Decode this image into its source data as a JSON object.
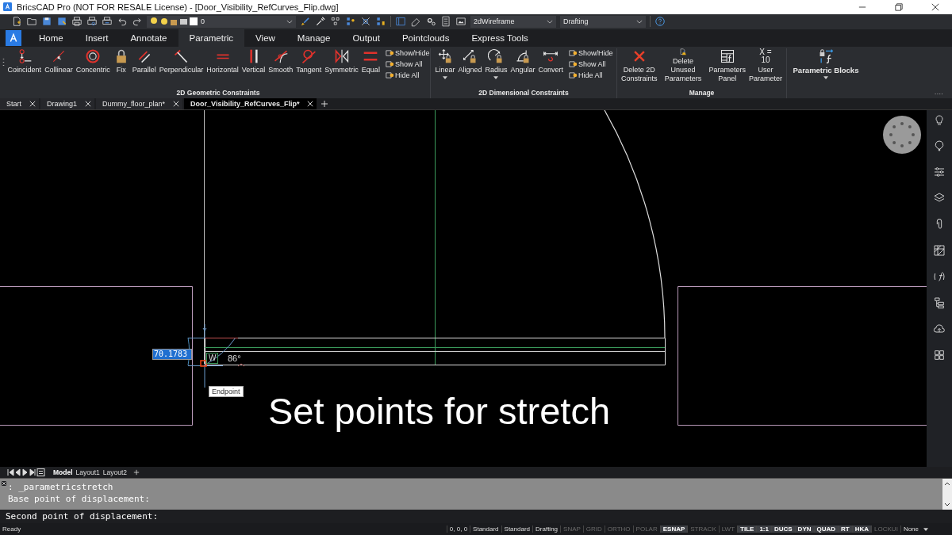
{
  "window": {
    "title": "BricsCAD Pro (NOT FOR RESALE License) - [Door_Visibility_RefCurves_Flip.dwg]"
  },
  "quick_access": {
    "layer": "0",
    "visual_style": "2dWireframe",
    "workspace": "Drafting"
  },
  "ribbon_tabs": [
    {
      "label": "Home",
      "selected": false
    },
    {
      "label": "Insert",
      "selected": false
    },
    {
      "label": "Annotate",
      "selected": false
    },
    {
      "label": "Parametric",
      "selected": true
    },
    {
      "label": "View",
      "selected": false
    },
    {
      "label": "Manage",
      "selected": false
    },
    {
      "label": "Output",
      "selected": false
    },
    {
      "label": "Pointclouds",
      "selected": false
    },
    {
      "label": "Express Tools",
      "selected": false
    }
  ],
  "ribbon_groups": [
    {
      "title": "2D Geometric Constraints",
      "buttons": [
        {
          "kind": "coincident",
          "label": "Coincident"
        },
        {
          "kind": "collinear",
          "label": "Collinear"
        },
        {
          "kind": "concentric",
          "label": "Concentric"
        },
        {
          "kind": "fix",
          "label": "Fix"
        },
        {
          "kind": "parallel",
          "label": "Parallel"
        },
        {
          "kind": "perpendicular",
          "label": "Perpendicular"
        },
        {
          "kind": "horizontal",
          "label": "Horizontal"
        },
        {
          "kind": "vertical",
          "label": "Vertical"
        },
        {
          "kind": "smooth",
          "label": "Smooth"
        },
        {
          "kind": "tangent",
          "label": "Tangent"
        },
        {
          "kind": "symmetric",
          "label": "Symmetric"
        },
        {
          "kind": "equal",
          "label": "Equal"
        }
      ],
      "small_buttons": [
        "Show/Hide",
        "Show All",
        "Hide All"
      ]
    },
    {
      "title": "2D Dimensional Constraints",
      "buttons": [
        {
          "kind": "linear",
          "label": "Linear",
          "dropdown": true
        },
        {
          "kind": "aligned",
          "label": "Aligned"
        },
        {
          "kind": "radius",
          "label": "Radius",
          "dropdown": true
        },
        {
          "kind": "angular",
          "label": "Angular"
        },
        {
          "kind": "convert",
          "label": "Convert"
        }
      ],
      "small_buttons": [
        "Show/Hide",
        "Show All",
        "Hide All"
      ]
    },
    {
      "title": "Manage",
      "buttons": [
        {
          "kind": "delete",
          "label": "Delete 2D\nConstraints"
        },
        {
          "kind": "purge",
          "label": "Delete Unused\nParameters"
        },
        {
          "kind": "panel",
          "label": "Parameters\nPanel"
        },
        {
          "kind": "userparam",
          "label": "User\nParameter",
          "icon_lines": [
            "X =",
            "10"
          ]
        }
      ]
    },
    {
      "buttons": [
        {
          "kind": "blocks",
          "label": "Parametric Blocks",
          "dropdown": true
        }
      ]
    }
  ],
  "document_tabs": [
    {
      "label": "Start",
      "selected": false
    },
    {
      "label": "Drawing1",
      "selected": false
    },
    {
      "label": "Dummy_floor_plan*",
      "selected": false
    },
    {
      "label": "Door_Visibility_RefCurves_Flip*",
      "selected": true
    }
  ],
  "dynamic_input": {
    "value": "70.1783",
    "snap_marker": "W",
    "angle": "86°",
    "tooltip": "Endpoint"
  },
  "caption": "Set points for stretch",
  "layout_tabs": [
    {
      "label": "Model",
      "selected": true
    },
    {
      "label": "Layout1",
      "selected": false
    },
    {
      "label": "Layout2",
      "selected": false
    }
  ],
  "command_history": [
    ": _parametricstretch",
    "Base point of displacement:"
  ],
  "command_prompt": "Second point of displacement:",
  "status_bar": {
    "message": "Ready",
    "coordinates": "0, 0, 0",
    "fields": [
      "Standard",
      "Standard",
      "Drafting"
    ],
    "toggles": [
      {
        "label": "SNAP",
        "on": false
      },
      {
        "label": "GRID",
        "on": false
      },
      {
        "label": "ORTHO",
        "on": false
      },
      {
        "label": "POLAR",
        "on": false
      },
      {
        "label": "ESNAP",
        "on": true
      },
      {
        "label": "STRACK",
        "on": false
      },
      {
        "label": "LWT",
        "on": false
      },
      {
        "label": "TILE",
        "on": true
      },
      {
        "label": "1:1",
        "on": true
      },
      {
        "label": "DUCS",
        "on": true
      },
      {
        "label": "DYN",
        "on": true
      },
      {
        "label": "QUAD",
        "on": true
      },
      {
        "label": "RT",
        "on": true
      },
      {
        "label": "HKA",
        "on": true
      },
      {
        "label": "LOCKUI",
        "on": false
      }
    ],
    "annotation": "None"
  }
}
